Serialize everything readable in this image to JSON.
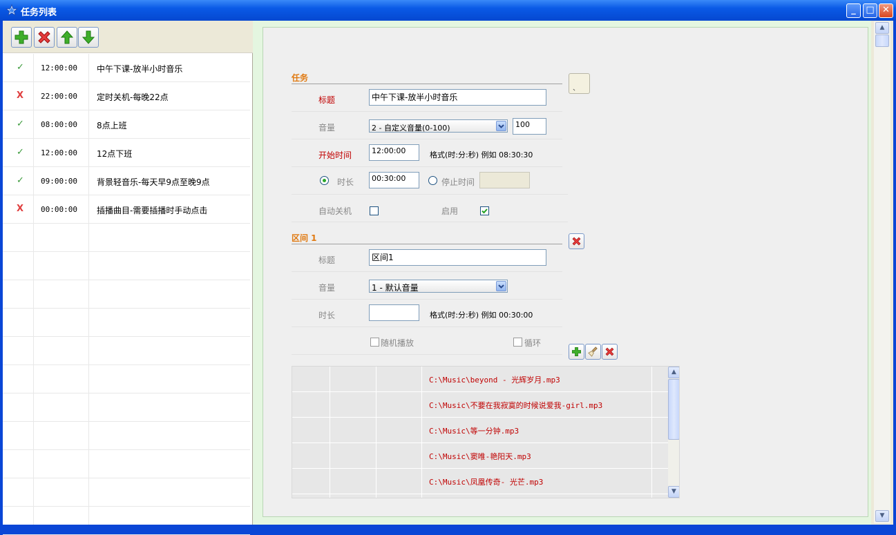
{
  "window": {
    "title": "任务列表",
    "icon": "star-icon"
  },
  "toolbar": {
    "buttons": [
      {
        "name": "add-task-button",
        "icon": "plus-icon"
      },
      {
        "name": "delete-task-button",
        "icon": "x-icon"
      },
      {
        "name": "move-up-button",
        "icon": "arrow-up-icon"
      },
      {
        "name": "move-down-button",
        "icon": "arrow-down-icon"
      }
    ]
  },
  "tasks": [
    {
      "status": "✓",
      "enabled": true,
      "time": "12:00:00",
      "name": "中午下课-放半小时音乐"
    },
    {
      "status": "X",
      "enabled": false,
      "time": "22:00:00",
      "name": "定时关机-每晚22点"
    },
    {
      "status": "✓",
      "enabled": true,
      "time": "08:00:00",
      "name": "8点上班"
    },
    {
      "status": "✓",
      "enabled": true,
      "time": "12:00:00",
      "name": "12点下班"
    },
    {
      "status": "✓",
      "enabled": true,
      "time": "09:00:00",
      "name": "背景轻音乐-每天早9点至晚9点"
    },
    {
      "status": "X",
      "enabled": false,
      "time": "00:00:00",
      "name": "插播曲目-需要插播时手动点击"
    }
  ],
  "task_section": {
    "title": "任务",
    "title_label": "标题",
    "title_value": "中午下课-放半小时音乐",
    "volume_label": "音量",
    "volume_selected": "2 - 自定义音量(0-100)",
    "volume_value": "100",
    "start_label": "开始时间",
    "start_value": "12:00:00",
    "format_hint": "格式(时:分:秒) 例如 08:30:30",
    "duration_label": "时长",
    "duration_value": "00:30:00",
    "stop_label": "停止时间",
    "stop_value": "",
    "auto_shutdown_label": "自动关机",
    "enable_label": "启用",
    "color_button_text": "、"
  },
  "interval_section": {
    "title": "区间 1",
    "title_label": "标题",
    "title_value": "区间1",
    "volume_label": "音量",
    "volume_selected": "1 - 默认音量",
    "duration_label": "时长",
    "duration_value": "",
    "format_hint": "格式(时:分:秒) 例如 00:30:00",
    "shuffle_label": "随机播放",
    "loop_label": "循环"
  },
  "files": [
    "C:\\Music\\beyond - 光辉岁月.mp3",
    "C:\\Music\\不要在我寂寞的时候说爱我-girl.mp3",
    "C:\\Music\\等一分钟.mp3",
    "C:\\Music\\窦唯-艳阳天.mp3",
    "C:\\Music\\凤凰传奇- 光芒.mp3"
  ],
  "colors": {
    "accent_orange": "#e07a12",
    "label_red": "#c00000",
    "check_green": "#3a9a3a",
    "x_red": "#e04040"
  }
}
